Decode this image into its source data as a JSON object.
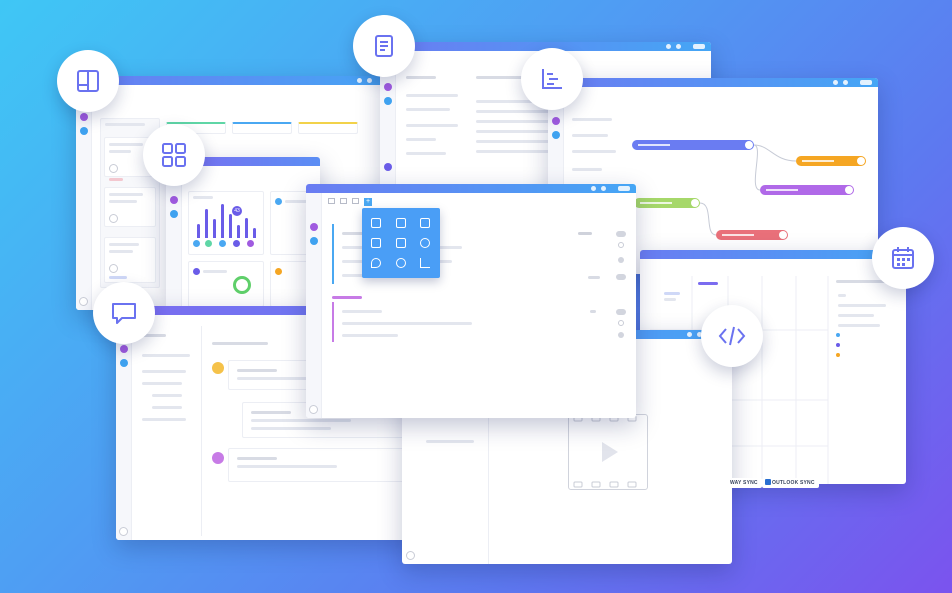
{
  "colors": {
    "bg_start": "#3fc7f5",
    "bg_end": "#7b53ee",
    "accent_purple": "#6a5ce8",
    "accent_blue": "#45a6f5",
    "gantt_blue": "#6a7cf2",
    "gantt_orange": "#f5a623",
    "gantt_violet": "#b069e8",
    "gantt_green": "#a6d86a",
    "gantt_red": "#e9707a"
  },
  "feature_icons": [
    {
      "name": "board-view-icon"
    },
    {
      "name": "docs-icon"
    },
    {
      "name": "gantt-icon"
    },
    {
      "name": "dashboard-icon"
    },
    {
      "name": "chat-icon"
    },
    {
      "name": "embed-code-icon"
    },
    {
      "name": "calendar-icon"
    }
  ],
  "dashboard": {
    "chart_values": [
      40,
      85,
      55,
      100,
      70,
      38,
      60,
      30
    ],
    "badge": "43"
  },
  "calendar": {
    "sync_labels": [
      "WAY SYNC",
      "OUTLOOK SYNC"
    ]
  }
}
